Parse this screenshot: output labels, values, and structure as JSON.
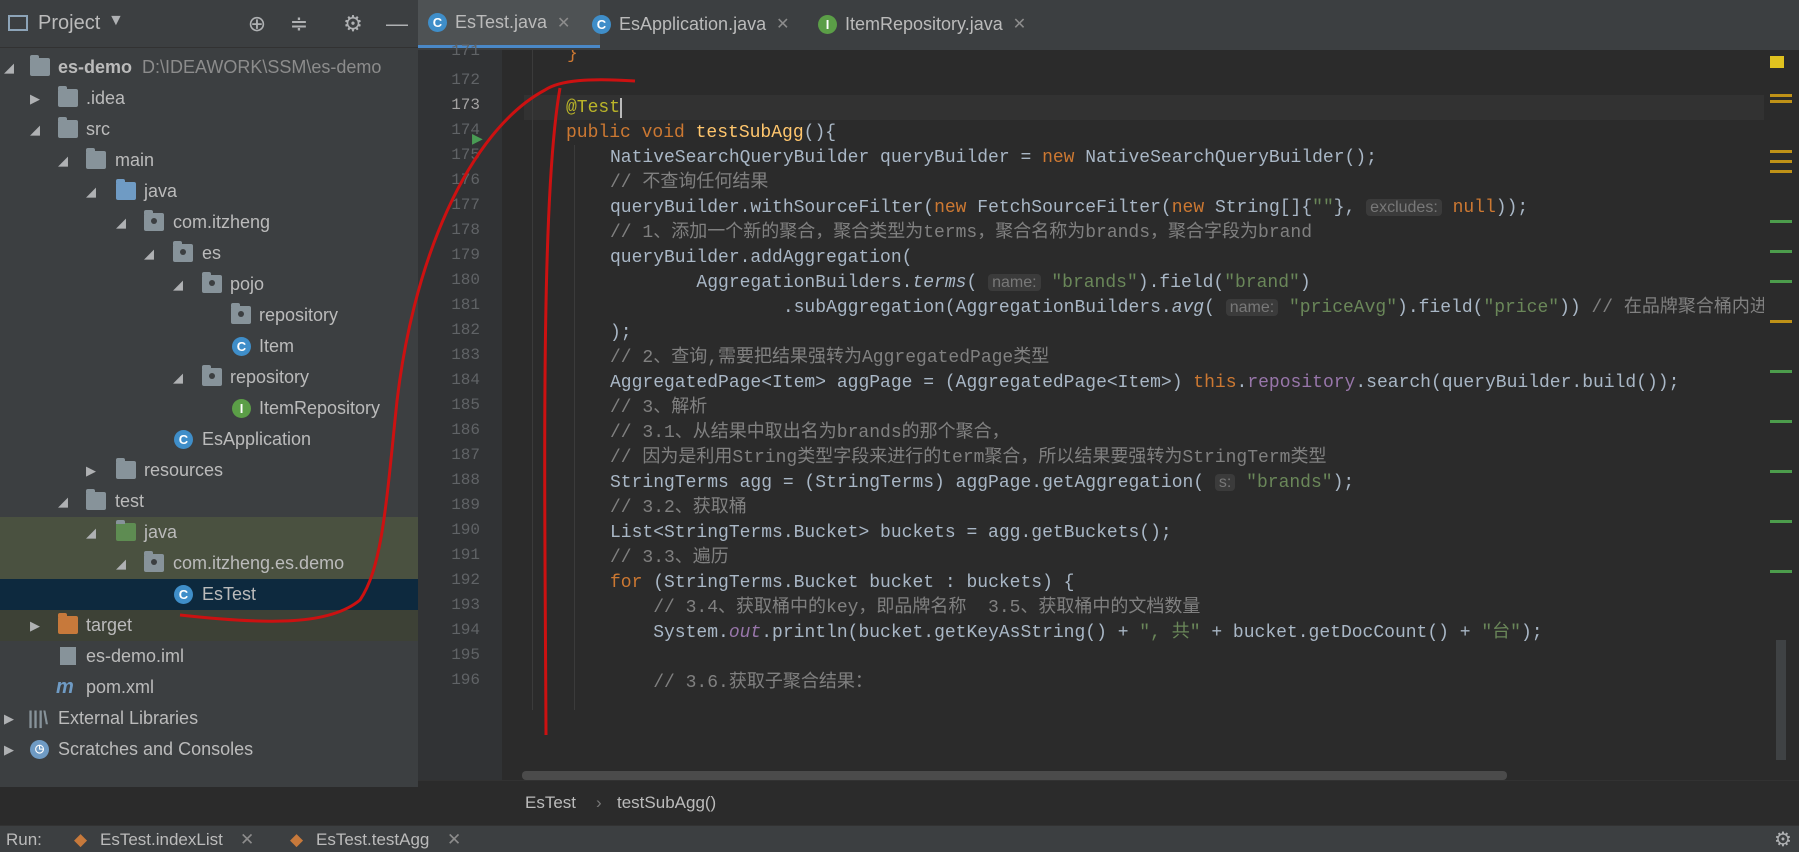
{
  "project_panel": {
    "title": "Project",
    "tree": [
      {
        "label": "es-demo",
        "hint": "D:\\IDEAWORK\\SSM\\es-demo"
      },
      {
        "label": ".idea"
      },
      {
        "label": "src"
      },
      {
        "label": "main"
      },
      {
        "label": "java"
      },
      {
        "label": "com.itzheng"
      },
      {
        "label": "es"
      },
      {
        "label": "pojo"
      },
      {
        "label": "repository"
      },
      {
        "label": "Item"
      },
      {
        "label": "repository"
      },
      {
        "label": "ItemRepository"
      },
      {
        "label": "EsApplication"
      },
      {
        "label": "resources"
      },
      {
        "label": "test"
      },
      {
        "label": "java"
      },
      {
        "label": "com.itzheng.es.demo"
      },
      {
        "label": "EsTest"
      },
      {
        "label": "target"
      },
      {
        "label": "es-demo.iml"
      },
      {
        "label": "pom.xml"
      },
      {
        "label": "External Libraries"
      },
      {
        "label": "Scratches and Consoles"
      }
    ]
  },
  "tabs": [
    {
      "label": "EsTest.java",
      "close": "✕"
    },
    {
      "label": "EsApplication.java",
      "close": "✕"
    },
    {
      "label": "ItemRepository.java",
      "close": "✕"
    }
  ],
  "line_numbers": [
    "171",
    "172",
    "173",
    "174",
    "175",
    "176",
    "177",
    "178",
    "179",
    "180",
    "181",
    "182",
    "183",
    "184",
    "185",
    "186",
    "187",
    "188",
    "189",
    "190",
    "191",
    "192",
    "193",
    "194",
    "195",
    "196"
  ],
  "code": {
    "l171": "}",
    "l173_anno": "@Test",
    "l174_a": "public void ",
    "l174_fn": "testSubAgg",
    "l174_b": "(){",
    "l175_a": "NativeSearchQueryBuilder queryBuilder = ",
    "l175_kw": "new ",
    "l175_b": "NativeSearchQueryBuilder();",
    "l176": "// 不查询任何结果",
    "l177_a": "queryBuilder.withSourceFilter(",
    "l177_kw1": "new ",
    "l177_b": "FetchSourceFilter(",
    "l177_kw2": "new ",
    "l177_c": "String[]{",
    "l177_str": "\"\"",
    "l177_d": "}, ",
    "l177_hint": "excludes:",
    "l177_kw3": " null",
    "l177_e": "));",
    "l178": "// 1、添加一个新的聚合，聚合类型为terms，聚合名称为brands，聚合字段为brand",
    "l179": "queryBuilder.addAggregation(",
    "l180_a": "        AggregationBuilders.",
    "l180_it": "terms",
    "l180_b": "( ",
    "l180_hint": "name:",
    "l180_str1": " \"brands\"",
    "l180_c": ").field(",
    "l180_str2": "\"brand\"",
    "l180_d": ")",
    "l181_a": "                .subAggregation(AggregationBuilders.",
    "l181_it": "avg",
    "l181_b": "( ",
    "l181_hint": "name:",
    "l181_str1": " \"priceAvg\"",
    "l181_c": ").field(",
    "l181_str2": "\"price\"",
    "l181_d": ")) ",
    "l181_cm": "// 在品牌聚合桶内进",
    "l182": ");",
    "l183": "// 2、查询,需要把结果强转为AggregatedPage类型",
    "l184_a": "AggregatedPage<Item> aggPage = (AggregatedPage<Item>) ",
    "l184_kw": "this",
    "l184_b": ".",
    "l184_fld": "repository",
    "l184_c": ".search(queryBuilder.build());",
    "l185": "// 3、解析",
    "l186": "// 3.1、从结果中取出名为brands的那个聚合，",
    "l187": "// 因为是利用String类型字段来进行的term聚合，所以结果要强转为StringTerm类型",
    "l188_a": "StringTerms agg = (StringTerms) aggPage.getAggregation( ",
    "l188_hint": "s:",
    "l188_str": " \"brands\"",
    "l188_b": ");",
    "l189": "// 3.2、获取桶",
    "l190": "List<StringTerms.Bucket> buckets = agg.getBuckets();",
    "l191": "// 3.3、遍历",
    "l192_kw": "for ",
    "l192_a": "(StringTerms.Bucket bucket : buckets) {",
    "l193": "    // 3.4、获取桶中的key，即品牌名称  3.5、获取桶中的文档数量",
    "l194_a": "    System.",
    "l194_fld": "out",
    "l194_b": ".println(bucket.getKeyAsString() + ",
    "l194_str1": "\", 共\"",
    "l194_c": " + bucket.getDocCount() + ",
    "l194_str2": "\"台\"",
    "l194_d": ");",
    "l196": "    // 3.6.获取子聚合结果："
  },
  "breadcrumb": {
    "file": "EsTest",
    "separator": "›",
    "method": "testSubAgg()"
  },
  "run_bar": {
    "label": "Run:",
    "tabs": [
      {
        "label": "EsTest.indexList",
        "close": "✕"
      },
      {
        "label": "EsTest.testAgg",
        "close": "✕"
      }
    ]
  },
  "colors": {
    "annotation": "#cc1111",
    "selection": "#0d293e",
    "accent": "#4a88c7"
  }
}
